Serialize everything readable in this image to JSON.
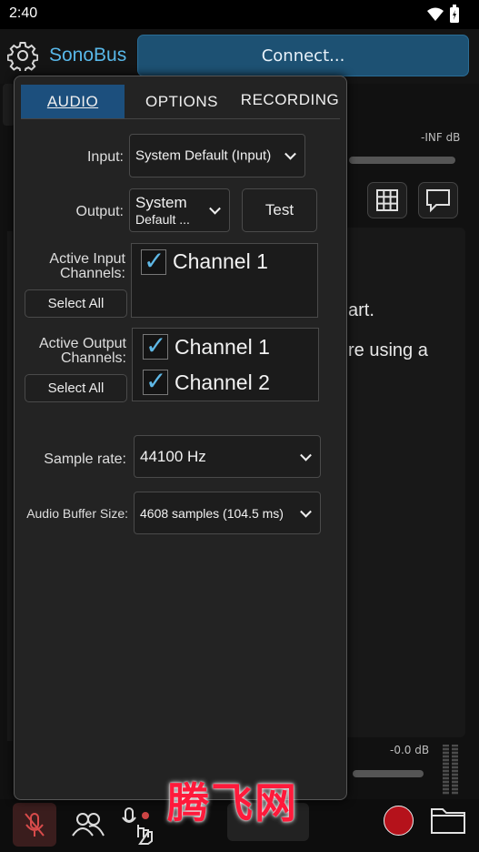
{
  "status": {
    "time": "2:40"
  },
  "header": {
    "app_name": "SonoBus",
    "connect_label": "Connect..."
  },
  "background": {
    "meter_top_label": "-INF dB",
    "meter_bottom_label": "-0.0 dB",
    "hint_line1": "art.",
    "hint_line2": "re using a"
  },
  "popup": {
    "tabs": [
      {
        "label": "AUDIO",
        "active": true
      },
      {
        "label": "OPTIONS",
        "active": false
      },
      {
        "label": "RECORDING",
        "active": false
      }
    ],
    "input": {
      "label": "Input:",
      "value": "System Default (Input)"
    },
    "output": {
      "label": "Output:",
      "value_line1": "System",
      "value_line2": "Default ...",
      "test_label": "Test"
    },
    "active_input": {
      "label_line1": "Active Input",
      "label_line2": "Channels:",
      "select_all": "Select All",
      "channels": [
        {
          "name": "Channel 1",
          "checked": true
        }
      ]
    },
    "active_output": {
      "label_line1": "Active Output",
      "label_line2": "Channels:",
      "select_all": "Select All",
      "channels": [
        {
          "name": "Channel 1",
          "checked": true
        },
        {
          "name": "Channel 2",
          "checked": true
        }
      ]
    },
    "sample_rate": {
      "label": "Sample rate:",
      "value": "44100 Hz"
    },
    "buffer": {
      "label": "Audio Buffer Size:",
      "value": "4608 samples (104.5 ms)"
    },
    "check_glyph": "✓"
  },
  "watermark": "腾飞网",
  "colors": {
    "accent": "#58b7e8",
    "tab_active": "#1c4f7d",
    "connect": "#1d5173",
    "record": "#b5121b"
  }
}
